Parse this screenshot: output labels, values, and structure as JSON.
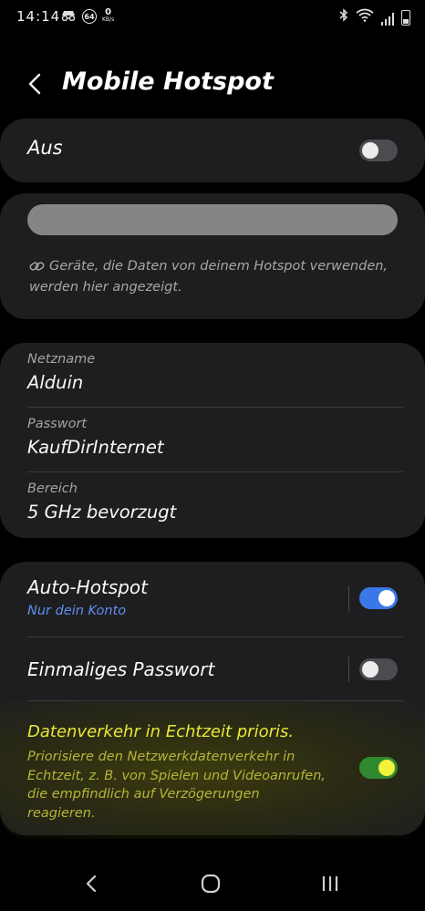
{
  "status_bar": {
    "time": "14:14",
    "badge": "64",
    "speed_value": "0",
    "speed_unit": "KB/s"
  },
  "header": {
    "title": "Mobile Hotspot"
  },
  "master": {
    "label": "Aus",
    "enabled": false
  },
  "devices": {
    "note": "Geräte, die Daten von deinem Hotspot verwenden, werden hier angezeigt."
  },
  "network": {
    "name_label": "Netzname",
    "name_value": "Alduin",
    "password_label": "Passwort",
    "password_value": "KaufDirInternet",
    "band_label": "Bereich",
    "band_value": "5 GHz bevorzugt"
  },
  "options": {
    "auto_hotspot_title": "Auto-Hotspot",
    "auto_hotspot_sub": "Nur dein Konto",
    "auto_hotspot_on": true,
    "one_time_password_title": "Einmaliges Passwort",
    "one_time_password_on": false,
    "realtime_title": "Datenverkehr in Echtzeit prioris.",
    "realtime_desc": "Priorisiere den Netzwerkdatenverkehr in Echtzeit, z. B. von Spielen und Videoanrufen, die empfindlich auf Verzögerungen reagieren.",
    "realtime_on": true
  },
  "colors": {
    "background": "#000000",
    "card": "#1e1e20",
    "accent_blue": "#3a78e8",
    "toggle_green": "#2f8a2f",
    "highlight_yellow": "#e8e83a"
  }
}
